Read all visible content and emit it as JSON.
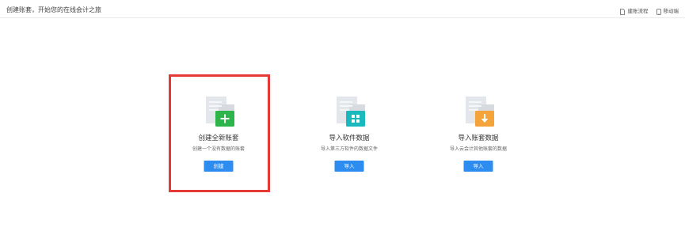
{
  "header": {
    "title": "创建账套，开始您的在线会计之旅",
    "actions": [
      {
        "label": "建账流程",
        "icon": "document-icon"
      },
      {
        "label": "移动端",
        "icon": "mobile-icon"
      }
    ]
  },
  "cards": [
    {
      "title": "创建全新账套",
      "description": "创建一个没有数据的账套",
      "button": "创建",
      "badge_icon": "plus-icon",
      "badge_color": "#2db44a"
    },
    {
      "title": "导入软件数据",
      "description": "导入第三方软件的数据文件",
      "button": "导入",
      "badge_icon": "grid-icon",
      "badge_color": "#19b9bd"
    },
    {
      "title": "导入账套数据",
      "description": "导入云会计其他账套的数据",
      "button": "导入",
      "badge_icon": "download-arrow-icon",
      "badge_color": "#f5a33b"
    }
  ],
  "colors": {
    "primary_button": "#2d8cf0",
    "highlight_border": "#e53935",
    "document_gray": "#e3e6ea"
  }
}
